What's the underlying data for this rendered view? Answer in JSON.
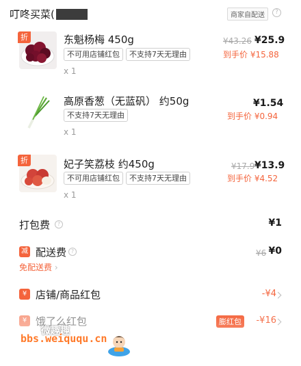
{
  "shop": {
    "name": "叮咚买菜(",
    "dispatch_tag": "商家自配送",
    "info_icon": "question-circle-icon"
  },
  "items": [
    {
      "title": "东魁杨梅 450g",
      "badge": "折",
      "tags": [
        "不可用店铺红包",
        "不支持7天无理由"
      ],
      "quantity": "x 1",
      "original_price": "¥43.26",
      "price": "¥25.9",
      "final_price": "到手价 ¥15.88"
    },
    {
      "title": "高原香葱（无蓝矾） 约50g",
      "badge": "",
      "tags": [
        "不支持7天无理由"
      ],
      "quantity": "x 1",
      "original_price": "",
      "price": "¥1.54",
      "final_price": "到手价 ¥0.94"
    },
    {
      "title": "妃子笑荔枝 约450g",
      "badge": "折",
      "tags": [
        "不可用店铺红包",
        "不支持7天无理由"
      ],
      "quantity": "x 1",
      "original_price": "¥17.9",
      "price": "¥13.9",
      "final_price": "到手价 ¥4.52"
    }
  ],
  "fees": {
    "packing_label": "打包费",
    "packing_value": "¥1",
    "delivery_icon": "减",
    "delivery_label": "配送费",
    "delivery_original": "¥6",
    "delivery_value": "¥0",
    "free_delivery_link": "免配送费"
  },
  "discounts": {
    "shop_redpack_icon": "¥",
    "shop_redpack_label": "店铺/商品红包",
    "shop_redpack_value": "-¥4",
    "eleme_redpack_icon": "¥",
    "eleme_redpack_label": "饿了么红包",
    "eleme_redpack_badge": "膨红包",
    "eleme_redpack_value": "-¥16"
  },
  "watermark": {
    "url": "bbs.weiququ.cn",
    "brand": "微趣趣"
  },
  "colors": {
    "accent": "#f4643c",
    "text": "#1a1a1a",
    "muted": "#999999"
  }
}
